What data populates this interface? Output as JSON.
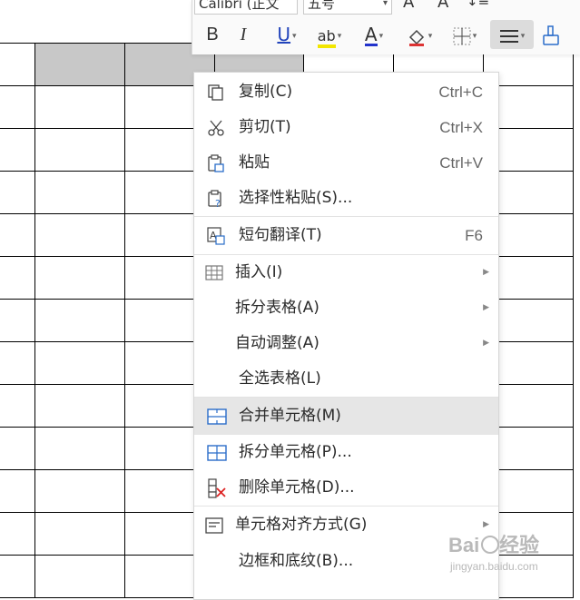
{
  "toolbar": {
    "font_name": "Calibri (正文",
    "font_size": "五号",
    "icons": [
      "bold-icon",
      "italic-icon",
      "underline-icon",
      "highlight-icon",
      "font-color-icon",
      "shading-icon",
      "borders-icon",
      "align-icon",
      "format-painter-icon"
    ],
    "bold": "B",
    "italic": "I",
    "underline": "U",
    "highlight": "ab",
    "font_color": "A"
  },
  "menu": {
    "items": [
      {
        "label": "复制(C)",
        "shortcut": "Ctrl+C",
        "icon": "copy-icon"
      },
      {
        "label": "剪切(T)",
        "shortcut": "Ctrl+X",
        "icon": "cut-icon"
      },
      {
        "label": "粘贴",
        "shortcut": "Ctrl+V",
        "icon": "paste-icon"
      },
      {
        "label": "选择性粘贴(S)...",
        "shortcut": "",
        "icon": "paste-special-icon"
      },
      {
        "label": "短句翻译(T)",
        "shortcut": "F6",
        "icon": "translate-icon"
      },
      {
        "label": "插入(I)",
        "shortcut": "",
        "icon": "table-insert-icon"
      },
      {
        "label": "拆分表格(A)",
        "shortcut": "",
        "icon": ""
      },
      {
        "label": "自动调整(A)",
        "shortcut": "",
        "icon": ""
      },
      {
        "label": "全选表格(L)",
        "shortcut": "",
        "icon": ""
      },
      {
        "label": "合并单元格(M)",
        "shortcut": "",
        "icon": "merge-cells-icon"
      },
      {
        "label": "拆分单元格(P)...",
        "shortcut": "",
        "icon": "split-cells-icon"
      },
      {
        "label": "删除单元格(D)...",
        "shortcut": "",
        "icon": "delete-cells-icon"
      },
      {
        "label": "单元格对齐方式(G)",
        "shortcut": "",
        "icon": "cell-align-icon"
      },
      {
        "label": "边框和底纹(B)...",
        "shortcut": "",
        "icon": ""
      }
    ]
  },
  "watermark": {
    "brand": "Baidu 经验",
    "url": "jingyan.baidu.com"
  },
  "colors": {
    "highlight_underline": "#f2e600",
    "font_color_underline": "#2233cc",
    "hover_bg": "#e6e6e6",
    "selected_cell": "#c8c8c8"
  }
}
